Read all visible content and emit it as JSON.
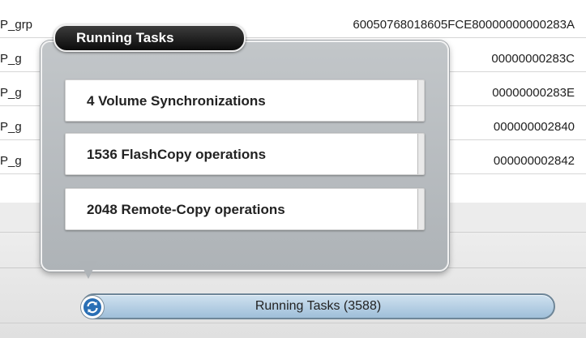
{
  "table": {
    "rows": [
      {
        "name": "P_grp",
        "id": "60050768018605FCE80000000000283A"
      },
      {
        "name": "P_g",
        "id": "00000000283C"
      },
      {
        "name": "P_g",
        "id": "00000000283E"
      },
      {
        "name": "P_g",
        "id": "000000002840"
      },
      {
        "name": "P_g",
        "id": "000000002842"
      },
      {
        "name": "",
        "id": ""
      }
    ]
  },
  "popup": {
    "title": "Running Tasks",
    "tasks": [
      {
        "label": "4 Volume Synchronizations"
      },
      {
        "label": "1536 FlashCopy operations"
      },
      {
        "label": "2048 Remote-Copy operations"
      }
    ]
  },
  "status_bar": {
    "label": "Running Tasks (3588)",
    "icon": "sync-icon"
  },
  "colors": {
    "popup_bg": "#b8bcc0",
    "title_bg": "#1a1a1a",
    "status_bar": "#b6d0e4",
    "icon_blue": "#2a6fb5"
  }
}
